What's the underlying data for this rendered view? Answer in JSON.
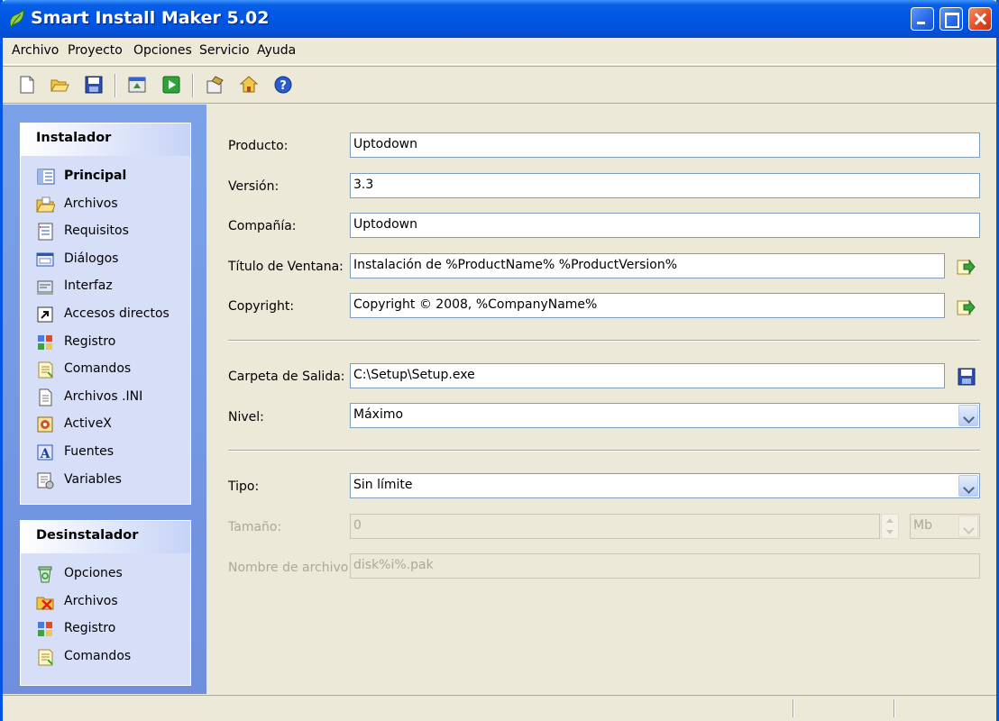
{
  "window": {
    "title": "Smart Install Maker 5.02"
  },
  "menu": [
    "Archivo",
    "Proyecto",
    "Opciones",
    "Servicio",
    "Ayuda"
  ],
  "toolbar": {
    "icons": [
      "new-file-icon",
      "open-folder-icon",
      "save-icon",
      "build-icon",
      "run-icon",
      "options-icon",
      "home-icon",
      "help-icon"
    ]
  },
  "sidebar": {
    "installer": {
      "title": "Instalador",
      "items": [
        {
          "label": "Principal",
          "icon": "main-page-icon",
          "selected": true
        },
        {
          "label": "Archivos",
          "icon": "folder-icon"
        },
        {
          "label": "Requisitos",
          "icon": "checklist-icon"
        },
        {
          "label": "Diálogos",
          "icon": "dialogs-icon"
        },
        {
          "label": "Interfaz",
          "icon": "interface-icon"
        },
        {
          "label": "Accesos directos",
          "icon": "shortcut-icon"
        },
        {
          "label": "Registro",
          "icon": "registry-icon"
        },
        {
          "label": "Comandos",
          "icon": "commands-icon"
        },
        {
          "label": "Archivos .INI",
          "icon": "ini-file-icon"
        },
        {
          "label": "ActiveX",
          "icon": "activex-icon"
        },
        {
          "label": "Fuentes",
          "icon": "font-icon"
        },
        {
          "label": "Variables",
          "icon": "variables-icon"
        }
      ]
    },
    "uninstaller": {
      "title": "Desinstalador",
      "items": [
        {
          "label": "Opciones",
          "icon": "recycle-icon"
        },
        {
          "label": "Archivos",
          "icon": "delete-files-icon"
        },
        {
          "label": "Registro",
          "icon": "registry-icon"
        },
        {
          "label": "Comandos",
          "icon": "commands-icon"
        }
      ]
    }
  },
  "form": {
    "product_label": "Producto:",
    "product_value": "Uptodown",
    "version_label": "Versión:",
    "version_value": "3.3",
    "company_label": "Compañía:",
    "company_value": "Uptodown",
    "window_title_label": "Título de Ventana:",
    "window_title_value": "Instalación de %ProductName% %ProductVersion%",
    "copyright_label": "Copyright:",
    "copyright_value": "Copyright © 2008, %CompanyName%",
    "output_label": "Carpeta de Salida:",
    "output_value": "C:\\Setup\\Setup.exe",
    "level_label": "Nivel:",
    "level_value": "Máximo",
    "type_label": "Tipo:",
    "type_value": "Sin límite",
    "size_label": "Tamaño:",
    "size_value": "0",
    "size_unit": "Mb",
    "filename_label": "Nombre de archivo:",
    "filename_value": "disk%i%.pak"
  },
  "colors": {
    "title_bar": "#0054e3",
    "sidebar_bg": "#7ba2e7",
    "group_bg": "#d6dff7"
  }
}
